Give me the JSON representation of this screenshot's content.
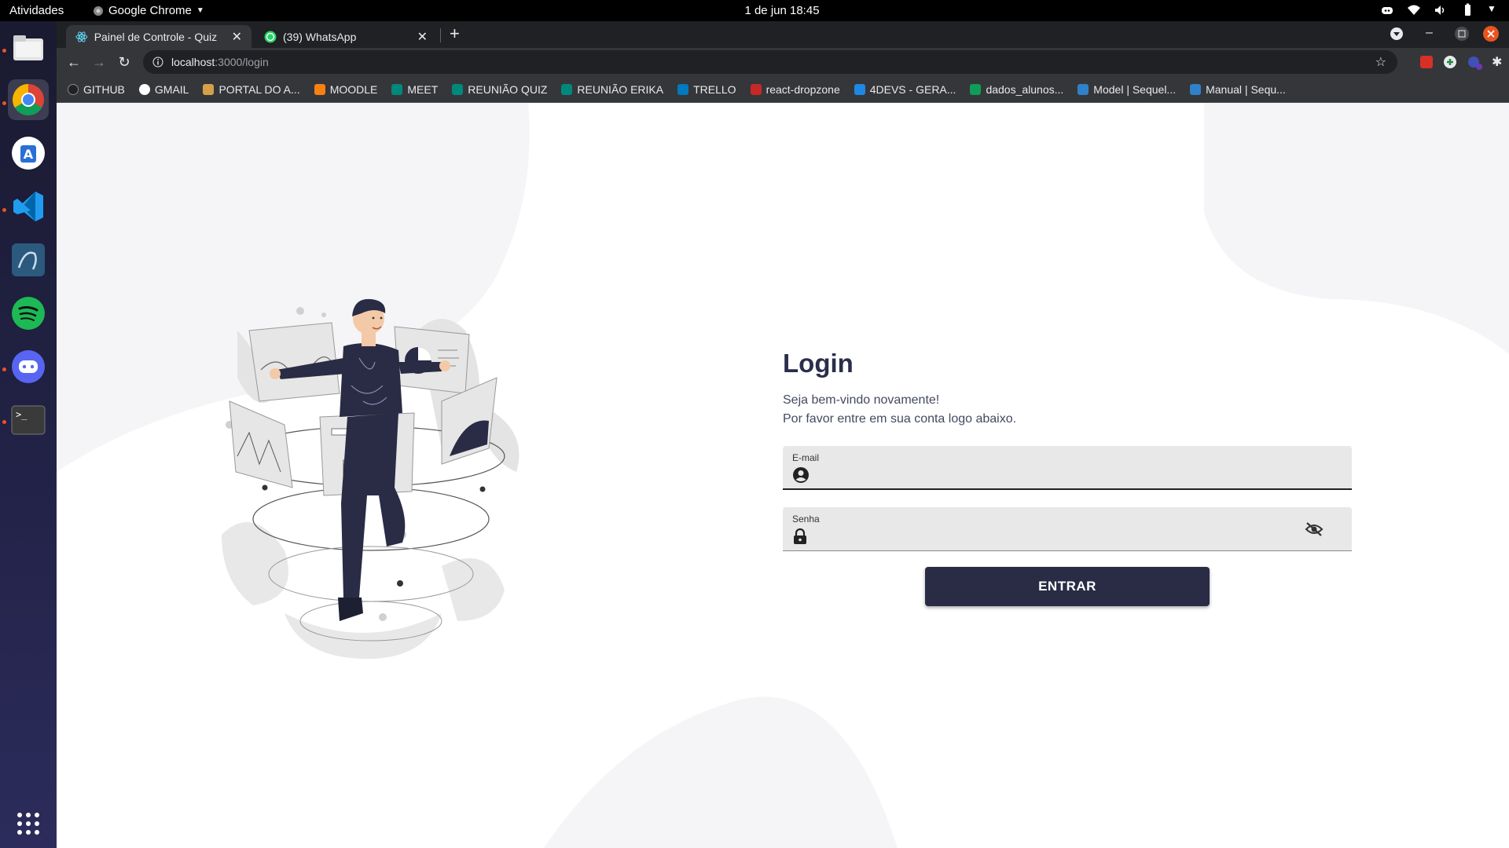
{
  "topbar": {
    "activities": "Atividades",
    "app_name": "Google Chrome",
    "clock": "1 de jun  18:45"
  },
  "dock": {
    "items": [
      "files-icon",
      "chrome-icon",
      "app-store-icon",
      "vscode-icon",
      "mysql-workbench-icon",
      "spotify-icon",
      "discord-icon",
      "terminal-icon"
    ],
    "apps_grid_icon": "apps-grid-icon"
  },
  "tabs": [
    {
      "title": "Painel de Controle - Quiz",
      "active": true
    },
    {
      "title": "(39) WhatsApp",
      "active": false
    }
  ],
  "omnibox": {
    "host": "localhost",
    "path": ":3000/login"
  },
  "bookmarks": [
    "GITHUB",
    "GMAIL",
    "PORTAL DO A...",
    "MOODLE",
    "MEET",
    "REUNIÃO QUIZ",
    "REUNIÃO ERIKA",
    "TRELLO",
    "react-dropzone",
    "4DEVS - GERA...",
    "dados_alunos...",
    "Model | Sequel...",
    "Manual | Sequ..."
  ],
  "login": {
    "title": "Login",
    "subtitle1": "Seja bem-vindo novamente!",
    "subtitle2": "Por favor entre em sua conta logo abaixo.",
    "email_label": "E-mail",
    "email_value": "",
    "password_label": "Senha",
    "password_value": "",
    "submit_label": "ENTRAR"
  },
  "colors": {
    "primary": "#2a2c45",
    "title": "#2a2e4a",
    "field_bg": "#e8e8e8",
    "chrome_dark": "#202124",
    "chrome_toolbar": "#35363a"
  }
}
